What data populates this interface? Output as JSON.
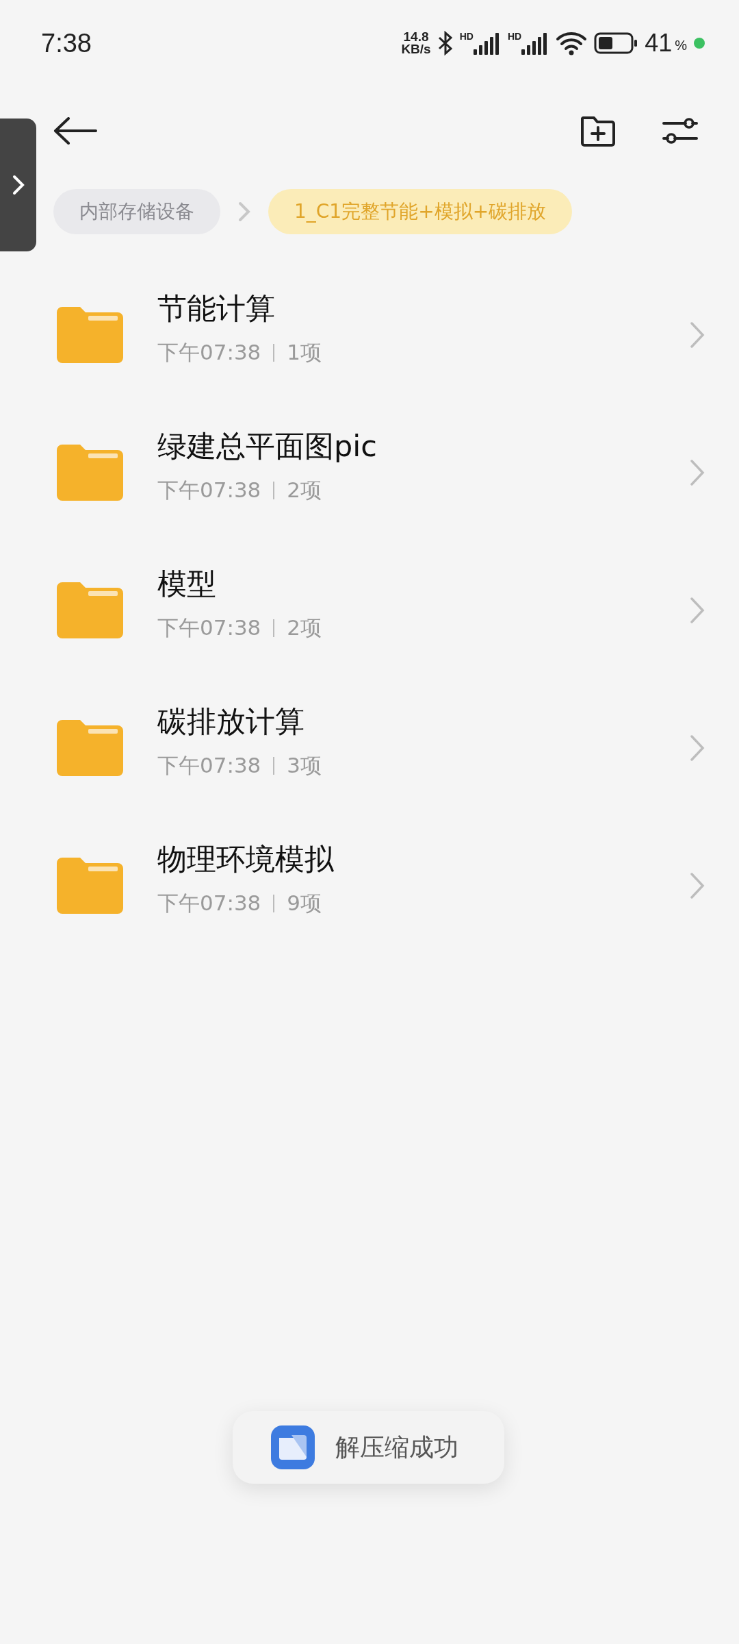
{
  "status_bar": {
    "time": "7:38",
    "net_speed": "14.8",
    "net_unit": "KB/s",
    "sim_labels": [
      "HD",
      "HD"
    ],
    "battery": "41",
    "battery_unit": "%"
  },
  "breadcrumbs": [
    {
      "label": "内部存储设备",
      "selected": false
    },
    {
      "label": "1_C1完整节能+模拟+碳排放",
      "selected": true
    }
  ],
  "folders": [
    {
      "name": "节能计算",
      "time": "下午07:38",
      "count": "1项"
    },
    {
      "name": "绿建总平面图pic",
      "time": "下午07:38",
      "count": "2项"
    },
    {
      "name": "模型",
      "time": "下午07:38",
      "count": "2项"
    },
    {
      "name": "碳排放计算",
      "time": "下午07:38",
      "count": "3项"
    },
    {
      "name": "物理环境模拟",
      "time": "下午07:38",
      "count": "9项"
    }
  ],
  "toast": {
    "message": "解压缩成功"
  }
}
